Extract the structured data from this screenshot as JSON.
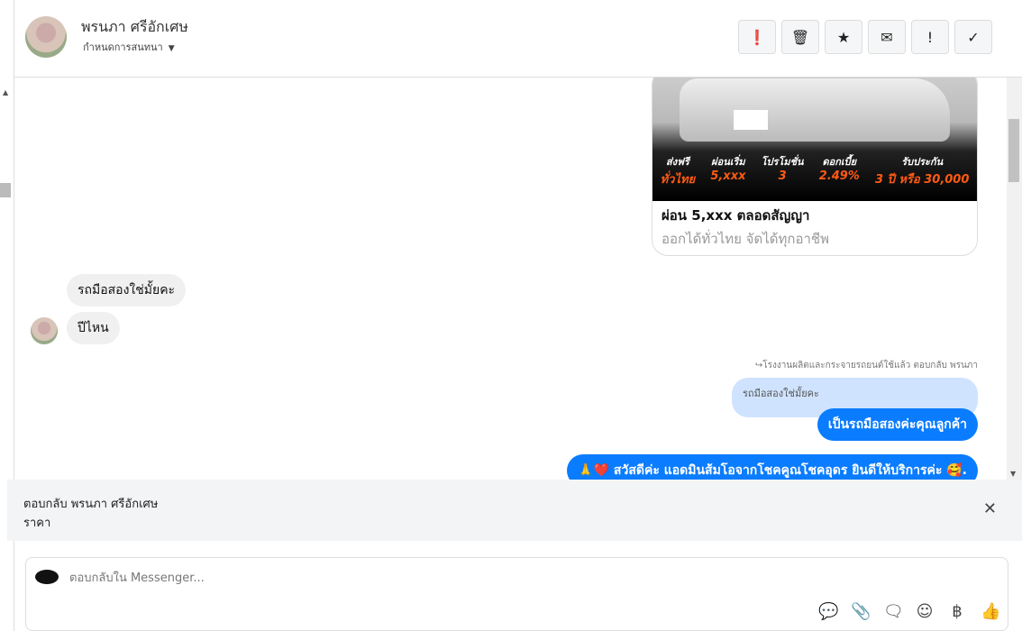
{
  "header": {
    "name": "พรนภา ศรีอักเศษ",
    "subtitle": "กำหนดการสนทนา",
    "buttons": [
      {
        "icon": "alert-circle-icon",
        "glyph": "❗"
      },
      {
        "icon": "trash-icon",
        "glyph": "🗑"
      },
      {
        "icon": "star-icon",
        "glyph": "★"
      },
      {
        "icon": "mail-icon",
        "glyph": "✉"
      },
      {
        "icon": "exclamation-icon",
        "glyph": "!"
      },
      {
        "icon": "check-icon",
        "glyph": "✓"
      }
    ]
  },
  "card": {
    "promos": [
      {
        "label": "ส่งฟรี",
        "value": "ทั่วไทย"
      },
      {
        "label": "ผ่อนเริ่ม",
        "value": "5,xxx"
      },
      {
        "label": "โปรโมชั่น",
        "value": "3"
      },
      {
        "label": "ดอกเบี้ย",
        "value": "2.49%"
      },
      {
        "label": "รับประกัน",
        "value": "3 ปี หรือ 30,000"
      }
    ],
    "title": "ผ่อน 5,xxx ตลอดสัญญา",
    "subtitle": "ออกได้ทั่วไทย จัดได้ทุกอาชีพ"
  },
  "messages": {
    "in1": "รถมือสองใช่มั้ยคะ",
    "in2": "ปีไหน",
    "reply_meta": "↪โรงงานผลิตและกระจายรถยนต์ใช้แล้ว ตอบกลับ พรนภา",
    "quoted": "รถมือสองใช่มั้ยคะ",
    "out1": "เป็นรถมือสองค่ะคุณลูกค้า",
    "out2": "🙏❤️ สวัสดีค่ะ แอดมินส้มโอจากโชคคูณโชคอุดร ยินดีให้บริการค่ะ 🥰."
  },
  "reply": {
    "to": "ตอบกลับ พรนภา ศรีอักเศษ",
    "text": "ราคา"
  },
  "composer": {
    "placeholder": "ตอบกลับใน Messenger...",
    "tools": [
      {
        "icon": "saved-reply-icon",
        "glyph": "💬"
      },
      {
        "icon": "paperclip-icon",
        "glyph": "📎"
      },
      {
        "icon": "chat-dots-icon",
        "glyph": "🗨"
      },
      {
        "icon": "emoji-icon",
        "glyph": "☺"
      },
      {
        "icon": "baht-icon",
        "glyph": "฿"
      },
      {
        "icon": "thumbs-up-icon",
        "glyph": "👍"
      }
    ]
  }
}
